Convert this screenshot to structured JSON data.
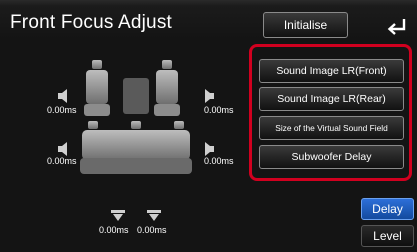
{
  "header": {
    "title": "Front Focus Adjust",
    "initialise_label": "Initialise"
  },
  "actions": [
    {
      "label": "Sound Image LR(Front)"
    },
    {
      "label": "Sound Image LR(Rear)"
    },
    {
      "label": "Size of the Virtual Sound Field"
    },
    {
      "label": "Subwoofer Delay"
    }
  ],
  "speakers": {
    "front_left": "0.00ms",
    "front_right": "0.00ms",
    "rear_left": "0.00ms",
    "rear_right": "0.00ms",
    "sub_left": "0.00ms",
    "sub_right": "0.00ms"
  },
  "tabs": {
    "delay": "Delay",
    "level": "Level"
  },
  "colors": {
    "highlight": "#d1001f",
    "active_tab": "#2d6fd8"
  }
}
